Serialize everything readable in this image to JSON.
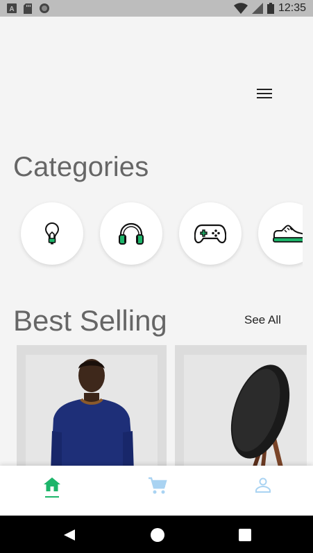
{
  "status_bar": {
    "time": "12:35",
    "icons": [
      "a-letter-icon",
      "sd-card-icon",
      "circle-notification-icon",
      "wifi-icon",
      "cell-signal-icon",
      "battery-icon"
    ]
  },
  "header": {
    "menu_icon": "hamburger-menu-icon"
  },
  "categories": {
    "title": "Categories",
    "items": [
      {
        "icon": "lightbulb-icon"
      },
      {
        "icon": "headphones-icon"
      },
      {
        "icon": "gamepad-icon"
      },
      {
        "icon": "sneaker-icon"
      }
    ]
  },
  "best_selling": {
    "title": "Best Selling",
    "see_all_label": "See All",
    "products": [
      {
        "image": "man-blue-sweater-photo"
      },
      {
        "image": "black-speaker-photo"
      }
    ]
  },
  "bottom_nav": {
    "items": [
      {
        "icon": "home-icon",
        "active": true
      },
      {
        "icon": "cart-icon",
        "active": false
      },
      {
        "icon": "profile-icon",
        "active": false
      }
    ],
    "accent": "#1db56a",
    "inactive": "#a9d3f2"
  },
  "system_nav": {
    "icons": [
      "back-icon",
      "home-circle-icon",
      "recents-icon"
    ]
  }
}
